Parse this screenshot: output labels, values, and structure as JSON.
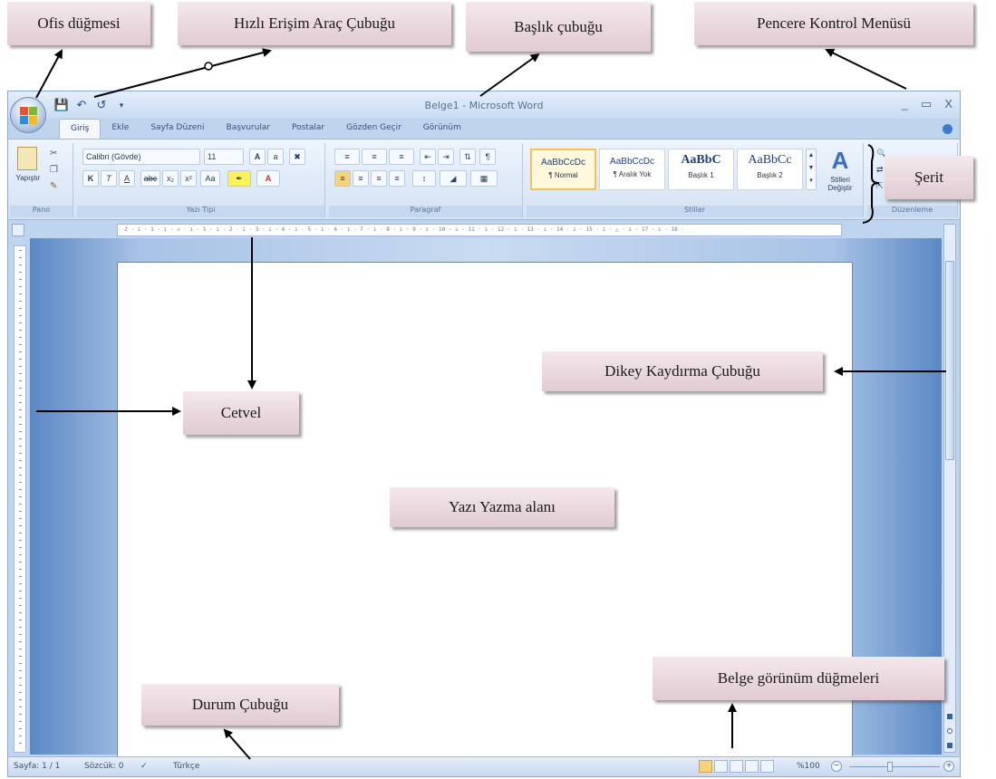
{
  "annotations": {
    "office_button": "Ofis düğmesi",
    "quick_access": "Hızlı Erişim Araç Çubuğu",
    "title_bar": "Başlık çubuğu",
    "window_control": "Pencere Kontrol Menüsü",
    "ribbon": "Şerit",
    "ruler": "Cetvel",
    "vertical_scroll": "Dikey Kaydırma Çubuğu",
    "writing_area": "Yazı Yazma alanı",
    "view_buttons": "Belge görünüm düğmeleri",
    "status_bar": "Durum Çubuğu"
  },
  "window": {
    "title": "Belge1 - Microsoft Word",
    "controls": [
      "_",
      "▭",
      "X"
    ]
  },
  "tabs": [
    "Giriş",
    "Ekle",
    "Sayfa Düzeni",
    "Başvurular",
    "Postalar",
    "Gözden Geçir",
    "Görünüm"
  ],
  "ribbon": {
    "groups": {
      "clipboard": "Pano",
      "font": "Yazı Tipi",
      "paragraph": "Paragraf",
      "styles": "Stiller",
      "editing": "Düzenleme"
    },
    "paste_label": "Yapıştır",
    "font_name": "Calibri (Gövde)",
    "font_size": "11",
    "styles": [
      {
        "sample": "AaBbCcDc",
        "name": "¶ Normal"
      },
      {
        "sample": "AaBbCcDc",
        "name": "¶ Aralık Yok"
      },
      {
        "sample": "AaBbC",
        "name": "Başlık 1"
      },
      {
        "sample": "AaBbCc",
        "name": "Başlık 2"
      }
    ],
    "change_styles": "Stilleri Değiştir"
  },
  "statusbar": {
    "page": "Sayfa: 1 / 1",
    "words": "Sözcük: 0",
    "language": "Türkçe",
    "zoom": "%100"
  },
  "colors": {
    "label_bg": "#e8d5db",
    "ribbon_bg": "#dbe7f6",
    "doc_bg": "#a8c3e6"
  }
}
